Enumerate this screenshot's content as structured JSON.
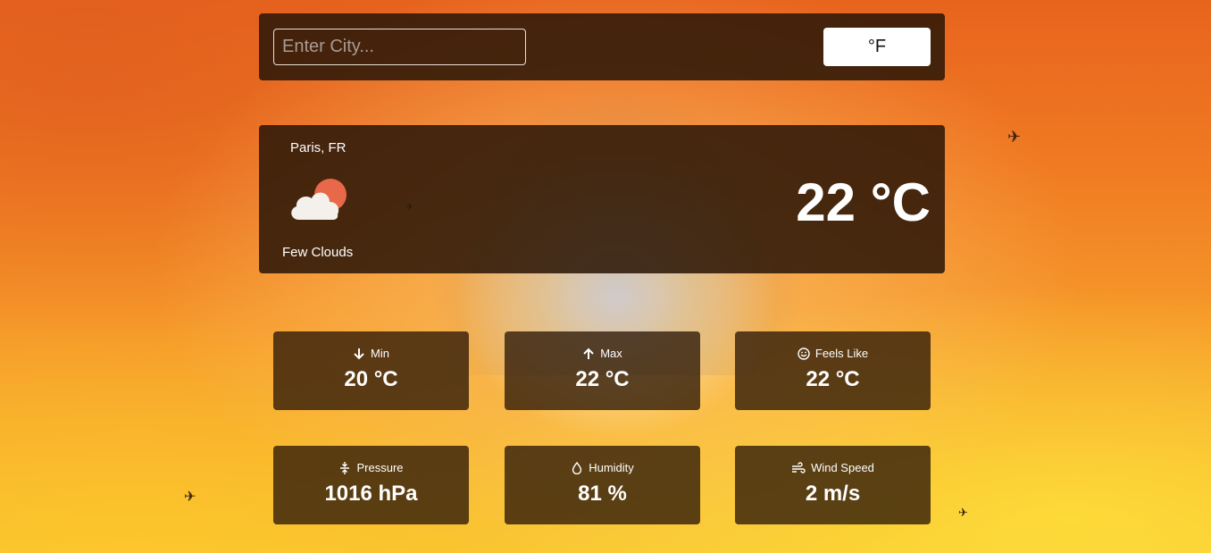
{
  "search": {
    "placeholder": "Enter City..."
  },
  "unit_toggle": {
    "label": "°F"
  },
  "current": {
    "location": "Paris, FR",
    "description": "Few Clouds",
    "temperature": "22 °C",
    "icon": "few-clouds-day-icon"
  },
  "stats": [
    {
      "label": "Min",
      "value": "20 °C",
      "icon": "arrow-down-icon"
    },
    {
      "label": "Max",
      "value": "22 °C",
      "icon": "arrow-up-icon"
    },
    {
      "label": "Feels Like",
      "value": "22 °C",
      "icon": "smiley-icon"
    },
    {
      "label": "Pressure",
      "value": "1016 hPa",
      "icon": "pressure-icon"
    },
    {
      "label": "Humidity",
      "value": "81 %",
      "icon": "droplet-icon"
    },
    {
      "label": "Wind Speed",
      "value": "2 m/s",
      "icon": "wind-icon"
    }
  ],
  "colors": {
    "panel": "#2d1808",
    "accent_sun": "#e8694a",
    "text": "#ffffff"
  }
}
